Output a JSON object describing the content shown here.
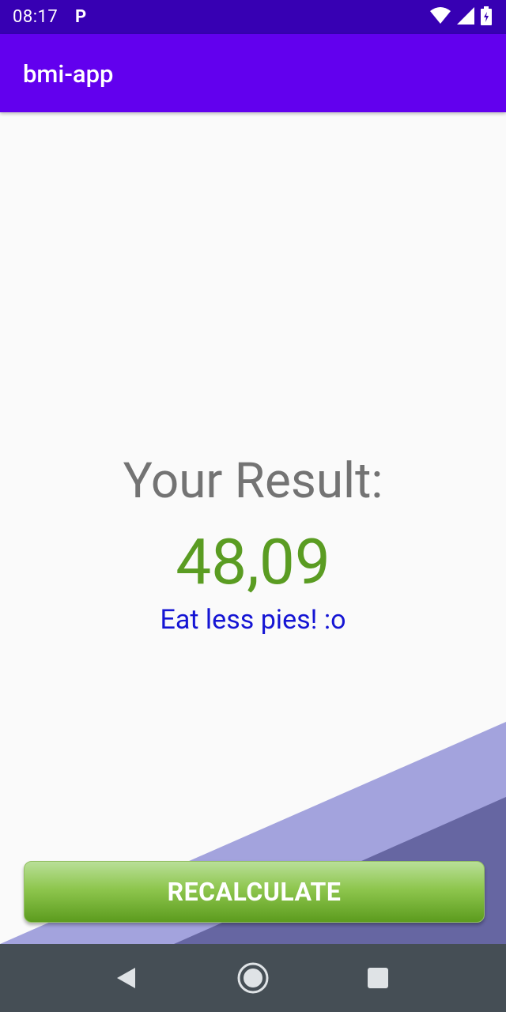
{
  "status_bar": {
    "time": "08:17",
    "notification_glyph": "P",
    "icons": [
      "wifi-icon",
      "signal-icon",
      "battery-icon"
    ]
  },
  "app_bar": {
    "title": "bmi-app"
  },
  "result": {
    "title": "Your Result:",
    "value": "48,09",
    "message": "Eat less pies! :o"
  },
  "button": {
    "label": "RECALCULATE"
  },
  "nav_bar": {
    "icons": [
      "back-icon",
      "home-icon",
      "recent-apps-icon"
    ]
  },
  "colors": {
    "status_bar": "#3700b3",
    "app_bar": "#6200ee",
    "result_value": "#5a9c22",
    "result_message": "#1515d4",
    "button_green": "#5c9c1e",
    "stripe_light": "#a3a3dd",
    "stripe_dark": "#6666a2",
    "nav_bar": "#454e55"
  }
}
